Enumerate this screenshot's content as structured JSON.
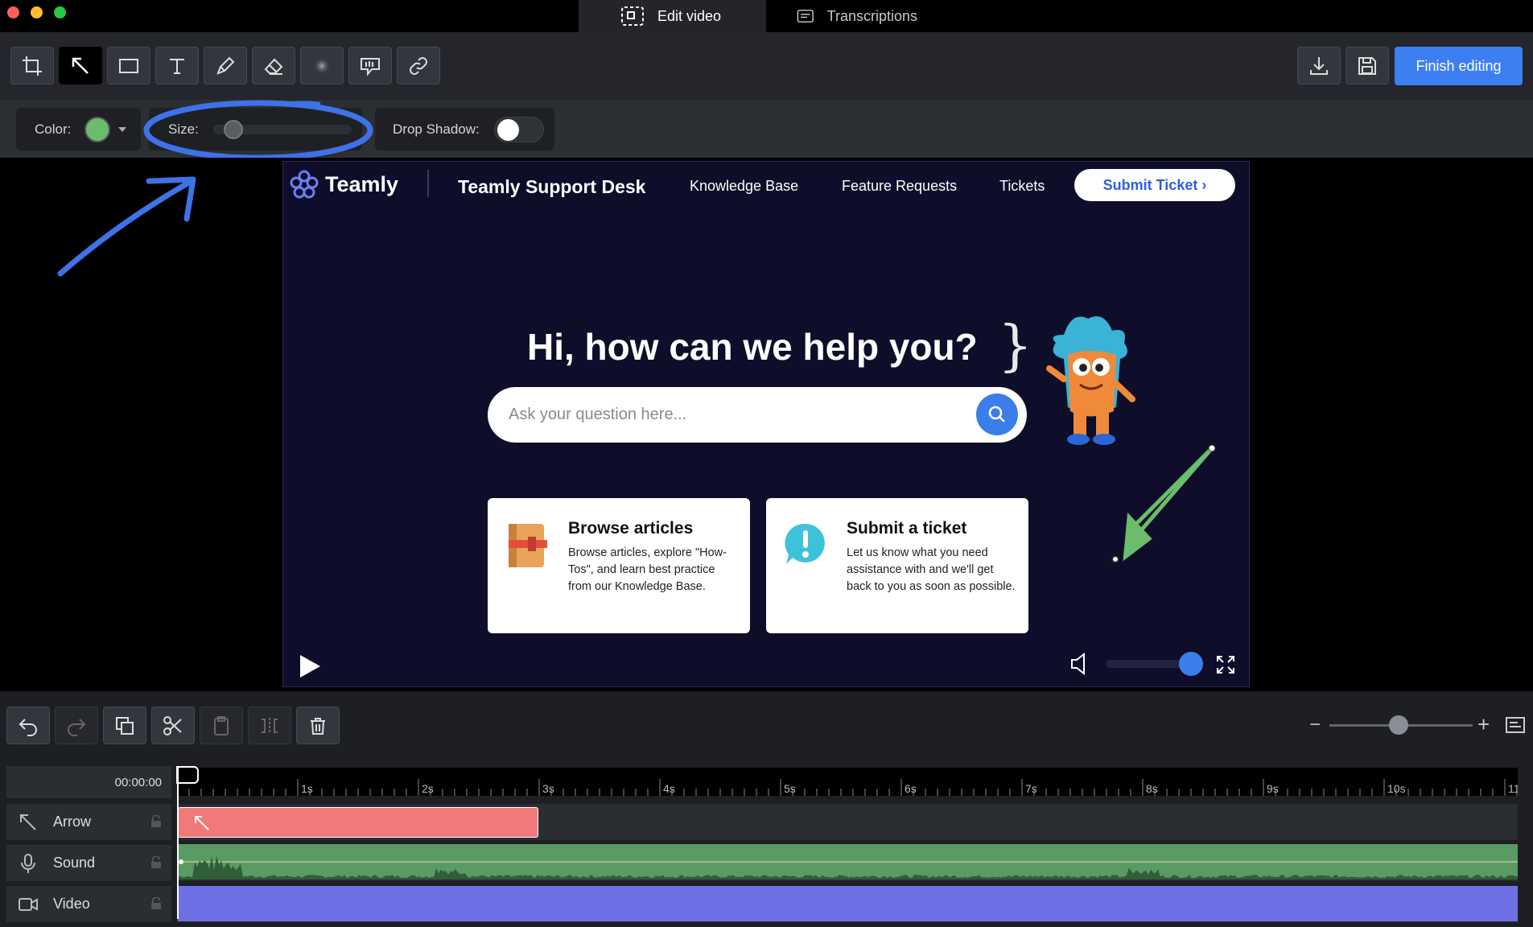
{
  "window": {
    "tabs": [
      {
        "label": "Edit video",
        "icon": "edit-video-icon",
        "active": true
      },
      {
        "label": "Transcriptions",
        "icon": "transcript-icon",
        "active": false
      }
    ]
  },
  "toolbar": {
    "tools": [
      "crop-icon",
      "arrow-icon",
      "rectangle-icon",
      "text-icon",
      "pen-icon",
      "eraser-icon",
      "blur-icon",
      "callout-icon",
      "link-icon"
    ],
    "active_tool": "arrow-icon",
    "finish_label": "Finish editing",
    "accent": "#3d7ff2"
  },
  "options": {
    "color_label": "Color:",
    "color_value": "#6bbd6b",
    "size_label": "Size:",
    "size_value": 0.1,
    "shadow_label": "Drop Shadow:",
    "shadow_on": false
  },
  "video": {
    "site": {
      "logo_text": "Teamly",
      "name": "Teamly Support Desk",
      "nav": [
        "Knowledge Base",
        "Feature Requests",
        "Tickets"
      ],
      "cta": "Submit Ticket ›"
    },
    "hero_title": "Hi, how can we help you?",
    "search_placeholder": "Ask your question here...",
    "cards": [
      {
        "title": "Browse articles",
        "desc": "Browse articles, explore \"How-Tos\", and learn best practice from our Knowledge Base."
      },
      {
        "title": "Submit a ticket",
        "desc": "Let us know what you need assistance with and we'll get back to you as soon as possible."
      }
    ],
    "volume": 1.0
  },
  "timeline": {
    "current_time": "00:00:00",
    "ruler_labels": [
      "1s",
      "2s",
      "3s",
      "4s",
      "5s",
      "6s",
      "7s",
      "8s",
      "9s",
      "10s",
      "11"
    ],
    "tracks": [
      {
        "label": "Arrow",
        "icon": "arrow-track-icon",
        "color": "#f07a7a"
      },
      {
        "label": "Sound",
        "icon": "microphone-icon",
        "color": "#5a9a63"
      },
      {
        "label": "Video",
        "icon": "video-camera-icon",
        "color": "#7070e6"
      }
    ],
    "zoom_level": 0.45
  }
}
